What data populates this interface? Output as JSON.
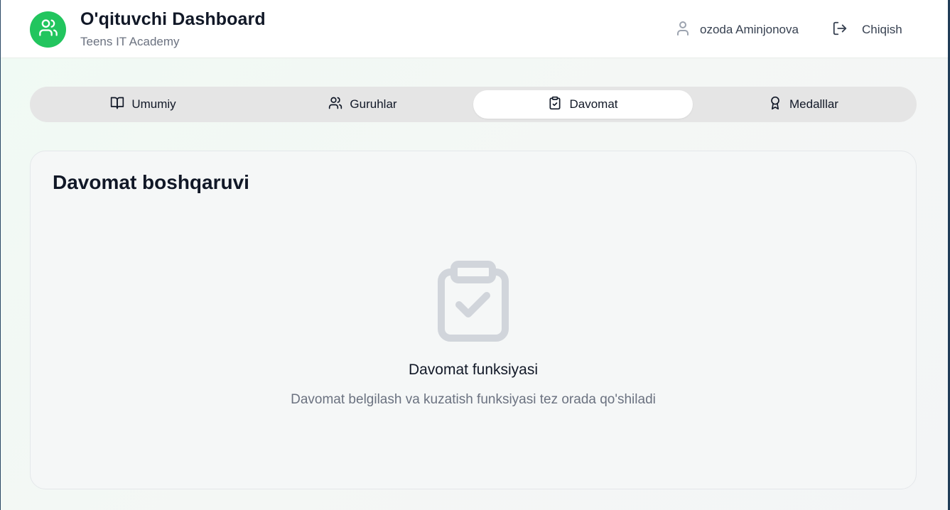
{
  "header": {
    "title": "O'qituvchi Dashboard",
    "subtitle": "Teens IT Academy",
    "logo_icon": "users-icon",
    "user_name": "ozoda Aminjonova",
    "logout_label": "Chiqish",
    "brand_color": "#22c55e"
  },
  "tabs": [
    {
      "label": "Umumiy",
      "icon": "book-open-icon",
      "active": false
    },
    {
      "label": "Guruhlar",
      "icon": "users-icon",
      "active": false
    },
    {
      "label": "Davomat",
      "icon": "clipboard-check-icon",
      "active": true
    },
    {
      "label": "Medalllar",
      "icon": "award-icon",
      "active": false
    }
  ],
  "card": {
    "title": "Davomat boshqaruvi",
    "empty_icon": "clipboard-check-icon",
    "empty_title": "Davomat funksiyasi",
    "empty_description": "Davomat belgilash va kuzatish funksiyasi tez orada qo'shiladi"
  }
}
